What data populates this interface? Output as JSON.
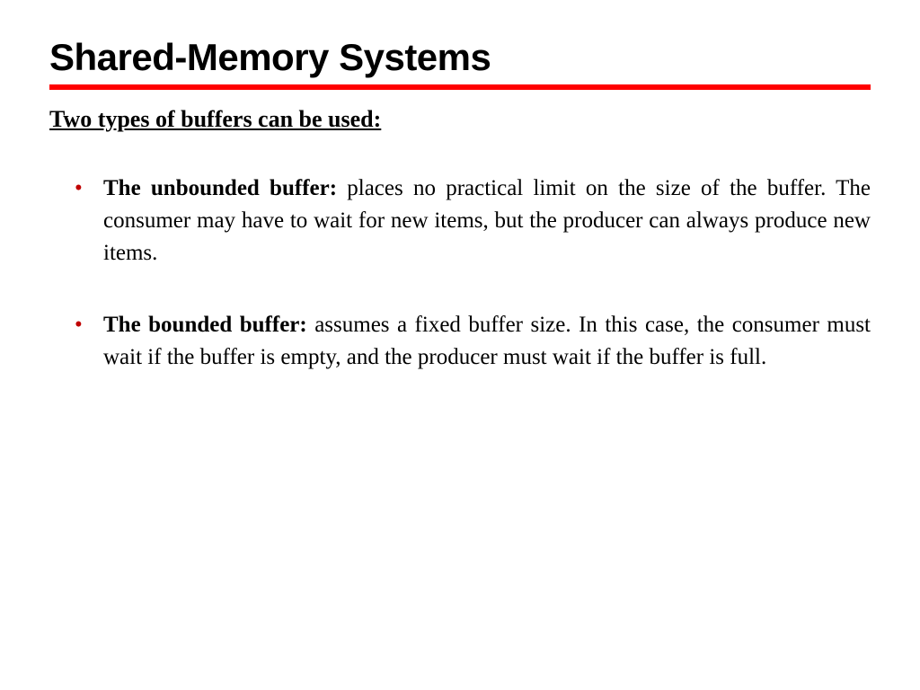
{
  "title": "Shared-Memory Systems",
  "subtitle": "Two types of buffers can be used:",
  "bullets": [
    {
      "lead": "The unbounded buffer: ",
      "text": "places no practical limit on the size of the buffer. The consumer may have to wait for new items, but the producer can always produce new items."
    },
    {
      "lead": "The bounded buffer: ",
      "text": "assumes a fixed buffer size. In this case, the consumer must wait if the buffer is empty, and the producer must wait if the buffer is full."
    }
  ]
}
